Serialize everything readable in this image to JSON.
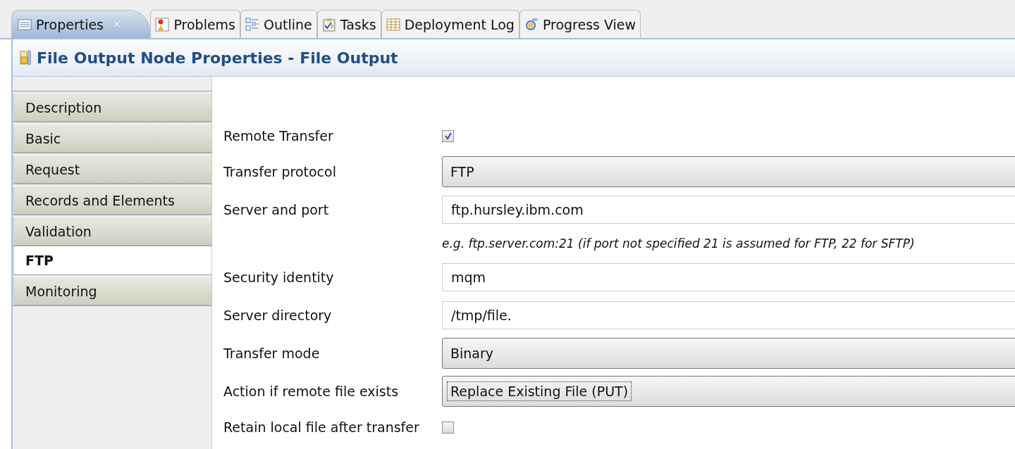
{
  "tabs": [
    {
      "label": "Properties",
      "kind": "list",
      "selected": true,
      "close": "✕"
    },
    {
      "label": "Problems",
      "kind": "problems",
      "selected": false
    },
    {
      "label": "Outline",
      "kind": "outline",
      "selected": false
    },
    {
      "label": "Tasks",
      "kind": "tasks",
      "selected": false
    },
    {
      "label": "Deployment Log",
      "kind": "table",
      "selected": false
    },
    {
      "label": "Progress View",
      "kind": "progress",
      "selected": false
    }
  ],
  "header": {
    "title": "File Output Node Properties - File Output"
  },
  "sidebar": {
    "items": [
      {
        "label": "Description",
        "selected": false
      },
      {
        "label": "Basic",
        "selected": false
      },
      {
        "label": "Request",
        "selected": false
      },
      {
        "label": "Records and Elements",
        "selected": false
      },
      {
        "label": "Validation",
        "selected": false
      },
      {
        "label": "FTP",
        "selected": true
      },
      {
        "label": "Monitoring",
        "selected": false
      }
    ]
  },
  "form": {
    "rows": [
      {
        "kind": "checkbox",
        "label": "Remote Transfer",
        "checked": true
      },
      {
        "kind": "dropdown",
        "label": "Transfer protocol",
        "value": "FTP",
        "focused": false
      },
      {
        "kind": "text",
        "label": "Server and port",
        "value": "ftp.hursley.ibm.com"
      },
      {
        "kind": "hint",
        "text": "e.g. ftp.server.com:21 (if port not specified 21 is assumed for FTP, 22 for SFTP)"
      },
      {
        "kind": "text",
        "label": "Security identity",
        "value": "mqm"
      },
      {
        "kind": "text",
        "label": "Server directory",
        "value": "/tmp/file."
      },
      {
        "kind": "dropdown",
        "label": "Transfer mode",
        "value": "Binary",
        "focused": false
      },
      {
        "kind": "dropdown",
        "label": "Action if remote file exists",
        "value": "Replace Existing File (PUT)",
        "focused": true
      },
      {
        "kind": "checkbox",
        "label": "Retain local file after transfer",
        "checked": false
      }
    ]
  }
}
